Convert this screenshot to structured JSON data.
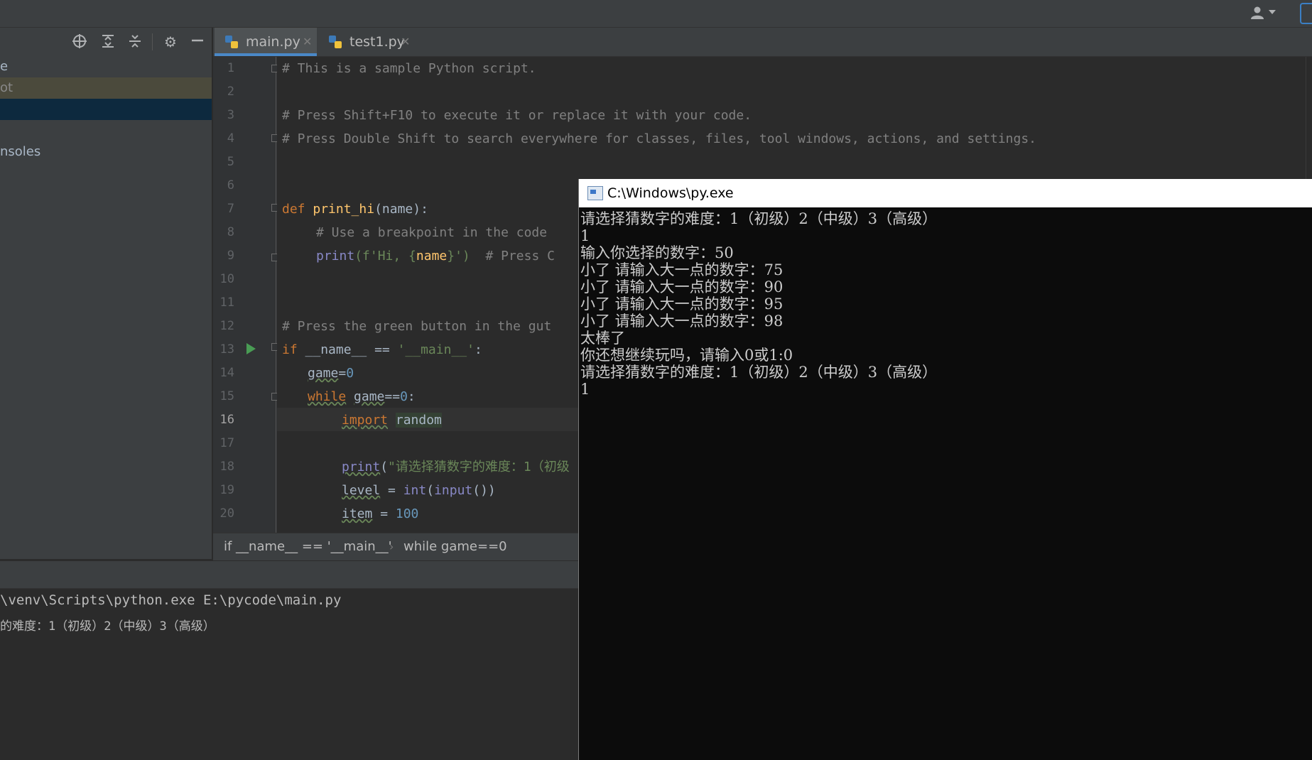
{
  "titlebar": {
    "user_icon": "user-icon"
  },
  "sidebar": {
    "toolbar_icons": [
      "crosshair-icon",
      "expand-all-icon",
      "collapse-all-icon",
      "gear-icon",
      "minimize-icon"
    ],
    "rows": [
      {
        "label": "e"
      },
      {
        "label": "ot"
      },
      {
        "label": ""
      },
      {
        "label": "nsoles"
      }
    ]
  },
  "tabs": [
    {
      "label": "main.py",
      "active": true
    },
    {
      "label": "test1.py",
      "active": false
    }
  ],
  "editor": {
    "line_numbers": [
      "1",
      "2",
      "3",
      "4",
      "5",
      "6",
      "7",
      "8",
      "9",
      "10",
      "11",
      "12",
      "13",
      "14",
      "15",
      "16",
      "17",
      "18",
      "19",
      "20"
    ],
    "current_line": "16",
    "code": {
      "l1": "# This is a sample Python script.",
      "l3": "# Press Shift+F10 to execute it or replace it with your code.",
      "l4": "# Press Double Shift to search everywhere for classes, files, tool windows, actions, and settings.",
      "l7_kw": "def",
      "l7_fn": "print_hi",
      "l7_rest": "(name):",
      "l8": "# Use a breakpoint in the code",
      "l9_fn": "print",
      "l9_a": "(f'Hi, {",
      "l9_b": "name",
      "l9_c": "}')",
      "l9_cm": "# Press C",
      "l12": "# Press the green button in the gut",
      "l13_kw": "if",
      "l13_a": "__name__ == ",
      "l13_str": "'__main__'",
      "l13_b": ":",
      "l14_var": "game",
      "l14_op": "=",
      "l14_num": "0",
      "l15_kw": "while",
      "l15_a": "game",
      "l15_b": "==",
      "l15_num": "0",
      "l15_c": ":",
      "l16_kw": "import",
      "l16_mod": "random",
      "l18_fn": "print",
      "l18_a": "(",
      "l18_str": "\"请选择猜数字的难度：1（初级",
      "l19_var": "level",
      "l19_a": " = ",
      "l19_int": "int",
      "l19_b": "(",
      "l19_input": "input",
      "l19_c": "())",
      "l20_var": "item",
      "l20_a": " = ",
      "l20_num": "100"
    }
  },
  "breadcrumbs": [
    "if __name__ == '__main__'",
    "while game==0"
  ],
  "console": {
    "lines": [
      "\\venv\\Scripts\\python.exe E:\\pycode\\main.py",
      "的难度：1（初级）2（中级）3（高级）"
    ]
  },
  "cmd_window": {
    "title": "C:\\Windows\\py.exe",
    "output": [
      "请选择猜数字的难度：1（初级）2（中级）3（高级）",
      "1",
      "输入你选择的数字：50",
      "小了 请输入大一点的数字：75",
      "小了 请输入大一点的数字：90",
      "小了 请输入大一点的数字：95",
      "小了 请输入大一点的数字：98",
      "太棒了",
      "你还想继续玩吗，请输入0或1:0",
      "请选择猜数字的难度：1（初级）2（中级）3（高级）",
      "1"
    ]
  },
  "colors": {
    "accent": "#4a88c7",
    "run": "#499c54",
    "selection": "#0d293e"
  }
}
